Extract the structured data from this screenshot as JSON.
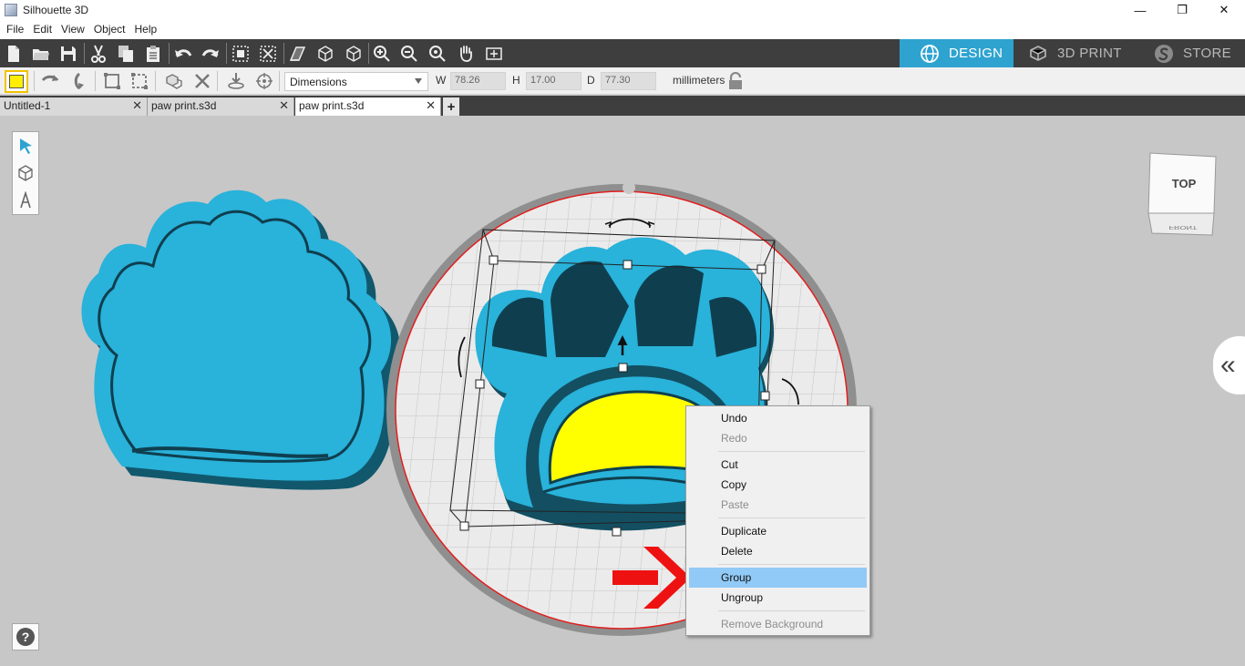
{
  "app": {
    "title": "Silhouette 3D"
  },
  "window_controls": {
    "minimize": "—",
    "restore": "❐",
    "close": "✕"
  },
  "menu": [
    "File",
    "Edit",
    "View",
    "Object",
    "Help"
  ],
  "modes": [
    {
      "label": "DESIGN",
      "icon": "globe-icon",
      "active": true
    },
    {
      "label": "3D PRINT",
      "icon": "printer-3d-icon",
      "active": false
    },
    {
      "label": "STORE",
      "icon": "store-s-icon",
      "active": false
    }
  ],
  "properties": {
    "fill_color": "#ffee00",
    "mode_select": "Dimensions",
    "w_label": "W",
    "w_value": "78.26",
    "h_label": "H",
    "h_value": "17.00",
    "d_label": "D",
    "d_value": "77.30",
    "units": "millimeters"
  },
  "tabs": [
    {
      "label": "Untitled-1",
      "active": false
    },
    {
      "label": "paw print.s3d",
      "active": false
    },
    {
      "label": "paw print.s3d",
      "active": true
    }
  ],
  "view_cube": {
    "top_label": "TOP",
    "front_label": "FRONT"
  },
  "context_menu": {
    "undo": "Undo",
    "redo": "Redo",
    "cut": "Cut",
    "copy": "Copy",
    "paste": "Paste",
    "duplicate": "Duplicate",
    "delete": "Delete",
    "group": "Group",
    "ungroup": "Ungroup",
    "remove_background": "Remove Background"
  },
  "help": {
    "label": "?"
  },
  "colors": {
    "accent": "#2ea3d0",
    "paw": "#29b2da",
    "insert": "#ffff00",
    "annotation_arrow": "#ee1111"
  }
}
